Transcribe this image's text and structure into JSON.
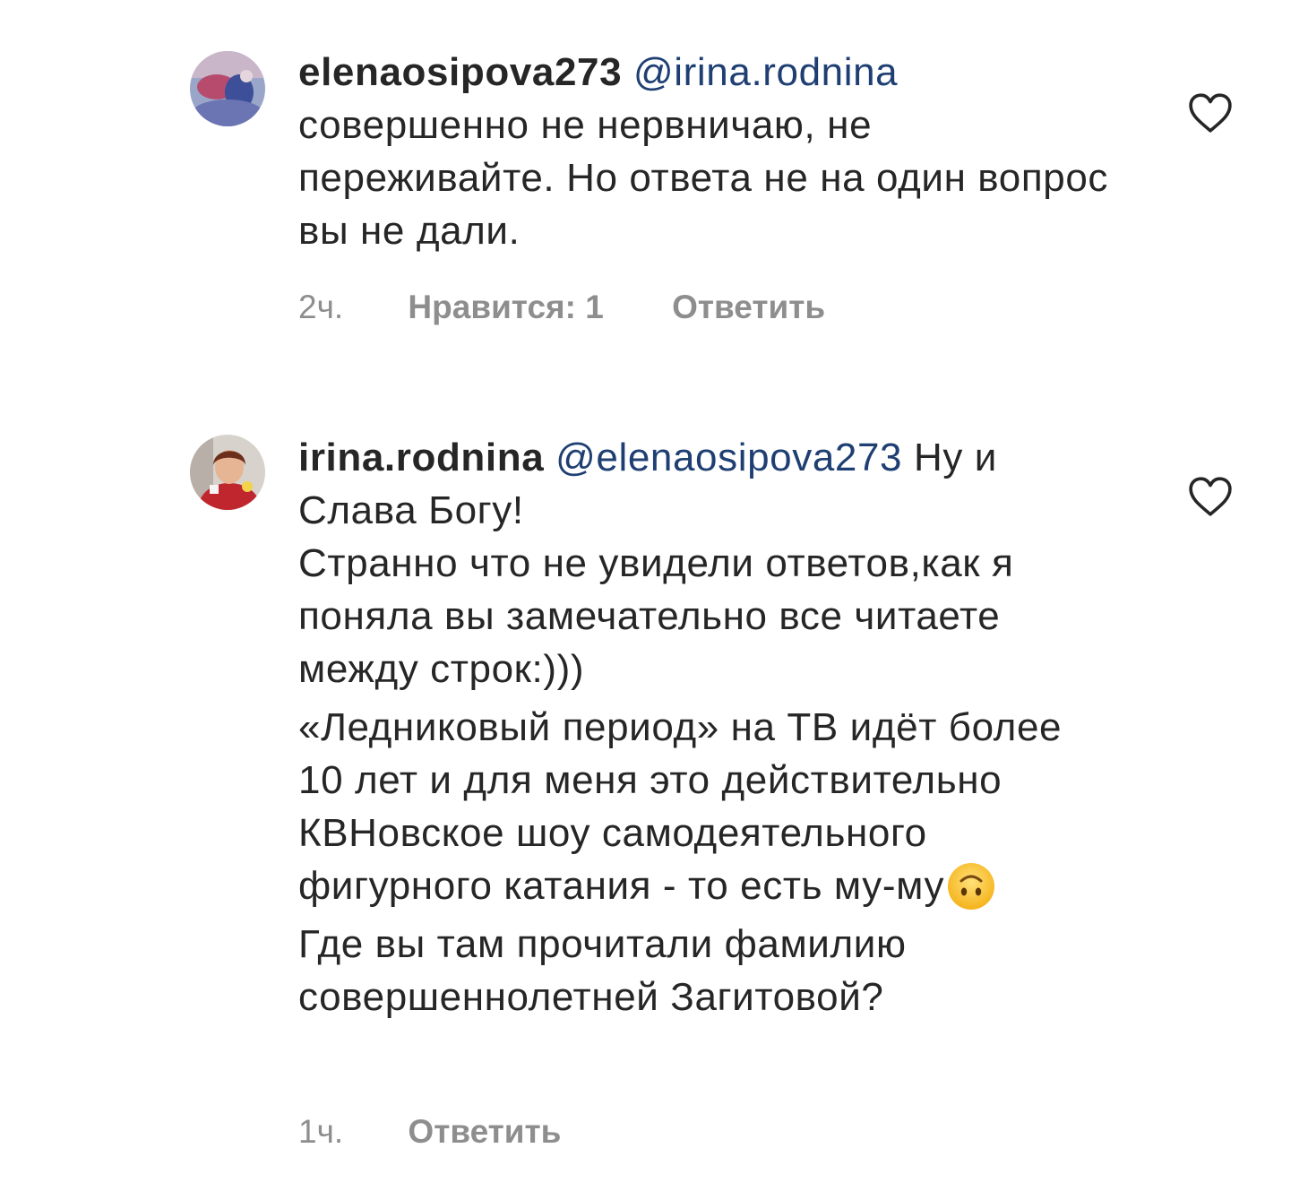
{
  "comments": [
    {
      "username": "elenaosipova273",
      "mention": "@irina.rodnina",
      "paragraphs": [
        "совершенно не нервничаю, не переживайте. Но ответа не на один вопрос вы не дали."
      ],
      "time": "2ч.",
      "likes": "Нравится: 1",
      "reply": "Ответить",
      "avatar_icon": "avatar-photo",
      "like_icon": "heart-outline-icon"
    },
    {
      "username": "irina.rodnina",
      "mention": "@elenaosipova273",
      "first_text": "Ну и Слава Богу!",
      "paragraphs": [
        "Странно что не увидели ответов,как я поняла вы замечательно все читаете между строк:)))",
        "«Ледниковый период» на ТВ идёт более 10 лет и для меня это действительно КВНовское шоу самодеятельного фигурного катания -  то есть му-му",
        "Где вы там прочитали  фамилию совершеннолетней Загитовой?"
      ],
      "emoji": "upside-down-face",
      "time": "1ч.",
      "reply": "Ответить",
      "avatar_icon": "avatar-photo",
      "like_icon": "heart-outline-icon"
    }
  ],
  "colors": {
    "text": "#262626",
    "mention": "#1f3f73",
    "meta": "#8e8e8e",
    "heart": "#262626"
  }
}
